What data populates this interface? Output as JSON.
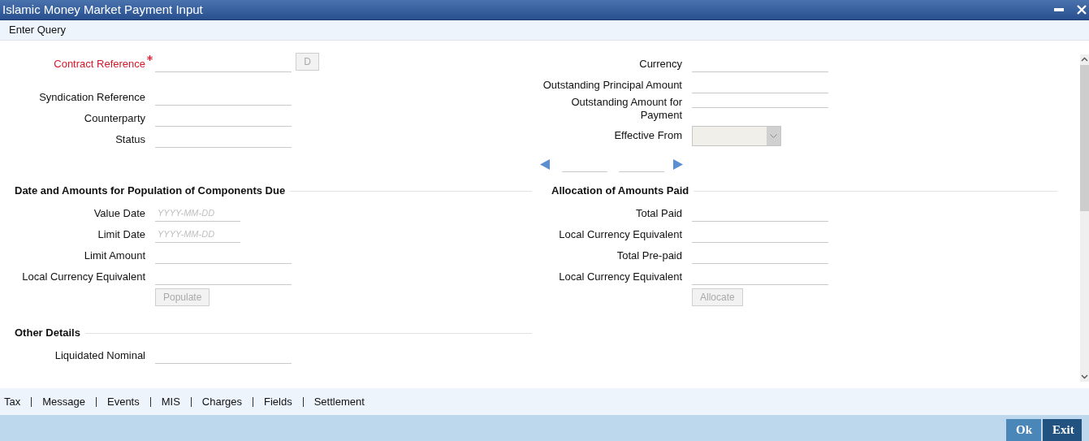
{
  "window": {
    "title": "Islamic Money Market Payment Input"
  },
  "toolbar": {
    "items": [
      "Enter Query"
    ]
  },
  "header_left": [
    {
      "label": "Contract Reference",
      "required": true,
      "kind": "text",
      "button": {
        "label": "D",
        "disabled": true
      }
    },
    {
      "label": "Syndication Reference",
      "required": false,
      "kind": "text"
    },
    {
      "label": "Counterparty",
      "required": false,
      "kind": "text"
    },
    {
      "label": "Status",
      "required": false,
      "kind": "text"
    }
  ],
  "header_right": [
    {
      "label": "Currency",
      "kind": "text"
    },
    {
      "label": "Outstanding Principal Amount",
      "kind": "text"
    },
    {
      "label": "Outstanding Amount for Payment",
      "kind": "text"
    },
    {
      "label": "Effective From",
      "kind": "select",
      "disabled": true
    }
  ],
  "sections": [
    {
      "title": "Date and Amounts for Population of Components Due",
      "fields": [
        {
          "label": "Value Date",
          "kind": "date",
          "placeholder": "YYYY-MM-DD"
        },
        {
          "label": "Limit Date",
          "kind": "date",
          "placeholder": "YYYY-MM-DD"
        },
        {
          "label": "Limit Amount",
          "kind": "text"
        },
        {
          "label": "Local Currency Equivalent",
          "kind": "text"
        }
      ],
      "button": {
        "label": "Populate",
        "disabled": true
      }
    },
    {
      "title": "Allocation of Amounts Paid",
      "fields": [
        {
          "label": "Total Paid",
          "kind": "text"
        },
        {
          "label": "Local Currency Equivalent",
          "kind": "text"
        },
        {
          "label": "Total Pre-paid",
          "kind": "text"
        },
        {
          "label": "Local Currency Equivalent",
          "kind": "text"
        }
      ],
      "button": {
        "label": "Allocate",
        "disabled": true
      }
    },
    {
      "title": "Other Details",
      "fields": [
        {
          "label": "Liquidated Nominal",
          "kind": "text"
        }
      ]
    }
  ],
  "tabs": [
    "Tax",
    "Message",
    "Events",
    "MIS",
    "Charges",
    "Fields",
    "Settlement"
  ],
  "buttons": [
    "Ok",
    "Exit"
  ]
}
